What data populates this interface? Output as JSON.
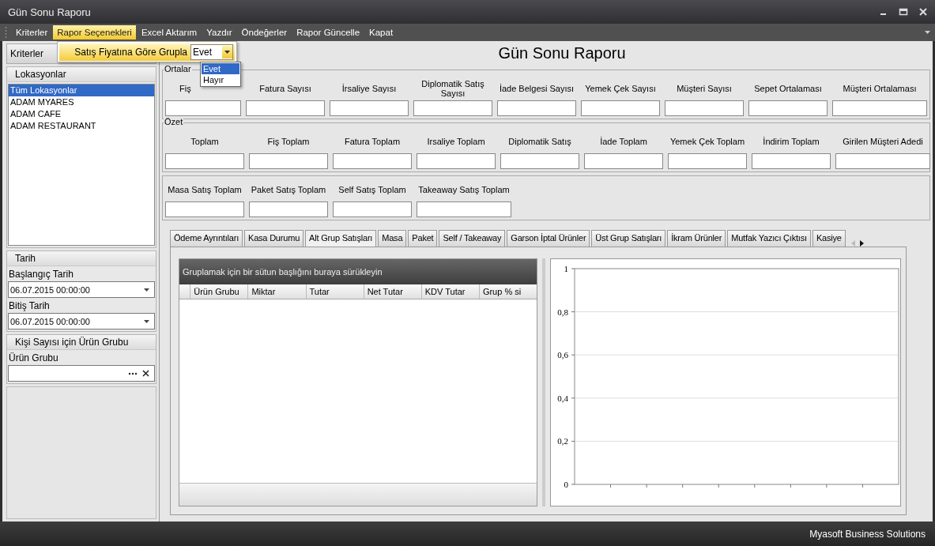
{
  "window": {
    "title": "Gün Sonu Raporu"
  },
  "menu": [
    {
      "label": "Kriterler",
      "selected": false
    },
    {
      "label": "Rapor Seçenekleri",
      "selected": true
    },
    {
      "label": "Excel Aktarım",
      "selected": false
    },
    {
      "label": "Yazdır",
      "selected": false
    },
    {
      "label": "Öndeğerler",
      "selected": false
    },
    {
      "label": "Rapor Güncelle",
      "selected": false
    },
    {
      "label": "Kapat",
      "selected": false
    }
  ],
  "menu_popup": {
    "label": "Satış Fiyatına Göre Grupla",
    "value": "Evet",
    "options": [
      {
        "label": "Evet",
        "selected": true
      },
      {
        "label": "Hayır",
        "selected": false
      }
    ]
  },
  "sidebar": {
    "title": "Kriterler",
    "locations": {
      "title": "Lokasyonlar",
      "items": [
        {
          "label": "Tüm Lokasyonlar",
          "selected": true
        },
        {
          "label": "ADAM MYARES",
          "selected": false
        },
        {
          "label": "ADAM CAFE",
          "selected": false
        },
        {
          "label": "ADAM RESTAURANT",
          "selected": false
        }
      ]
    },
    "date": {
      "title": "Tarih",
      "fields": [
        {
          "label": "Başlangıç Tarih",
          "value": "06.07.2015 00:00:00"
        },
        {
          "label": "Bitiş Tarih",
          "value": "06.07.2015 00:00:00"
        }
      ]
    },
    "product_group": {
      "title": "Kişi Sayısı için Ürün Grubu",
      "label": "Ürün Grubu"
    }
  },
  "report_title": "Gün Sonu Raporu",
  "groups": [
    {
      "title": "Ortalar",
      "fields": [
        "Fiş",
        "Fatura Sayısı",
        "İrsaliye Sayısı",
        "Diplomatik Satış Sayısı",
        "İade Belgesi Sayısı",
        "Yemek Çek Sayısı",
        "Müşteri Sayısı",
        "Sepet Ortalaması",
        "Müşteri Ortalaması"
      ]
    },
    {
      "title": "Özet",
      "fields": [
        "Toplam",
        "Fiş Toplam",
        "Fatura Toplam",
        "Irsaliye Toplam",
        "Diplomatik Satış",
        "İade Toplam",
        "Yemek Çek Toplam",
        "İndirim Toplam",
        "Girilen Müşteri Adedi"
      ]
    },
    {
      "fields": [
        "Masa Satış Toplam",
        "Paket Satış Toplam",
        "Self Satış Toplam",
        "Takeaway Satış Toplam"
      ]
    }
  ],
  "tabs": [
    {
      "label": "Ödeme Ayrıntıları",
      "selected": false
    },
    {
      "label": "Kasa Durumu",
      "selected": false
    },
    {
      "label": "Alt Grup Satışları",
      "selected": true
    },
    {
      "label": "Masa",
      "selected": false
    },
    {
      "label": "Paket",
      "selected": false
    },
    {
      "label": "Self / Takeaway",
      "selected": false
    },
    {
      "label": "Garson İptal Ürünler",
      "selected": false
    },
    {
      "label": "Üst Grup Satışları",
      "selected": false
    },
    {
      "label": "İkram Ürünler",
      "selected": false
    },
    {
      "label": "Mutfak Yazıcı Çıktısı",
      "selected": false
    },
    {
      "label": "Kasiye",
      "selected": false
    }
  ],
  "grid": {
    "group_hint": "Gruplamak için bir sütun başlığını buraya sürükleyin",
    "columns": [
      "Ürün Grubu",
      "Miktar",
      "Tutar",
      "Net Tutar",
      "KDV Tutar",
      "Grup % si"
    ]
  },
  "chart": {
    "y_labels": [
      "1",
      "0,8",
      "0,6",
      "0,4",
      "0,2",
      "0"
    ]
  },
  "status_bar": "Myasoft Business Solutions"
}
